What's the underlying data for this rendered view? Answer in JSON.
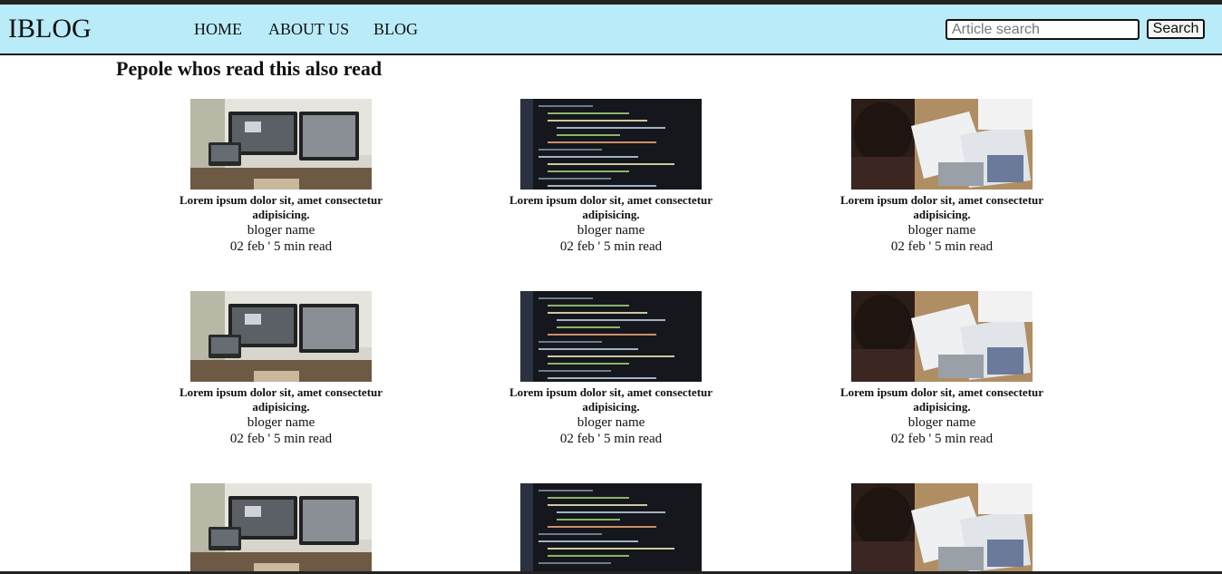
{
  "brand": "IBLOG",
  "nav": [
    {
      "label": "HOME"
    },
    {
      "label": "ABOUT US"
    },
    {
      "label": "BLOG"
    }
  ],
  "search": {
    "placeholder": "Article search",
    "button": "Search"
  },
  "section_title": "Pepole whos read this also read",
  "colors": {
    "navbar_bg": "#b9ebf8",
    "text": "#111111"
  },
  "cards": [
    {
      "image": "desk-monitors-image",
      "title": "Lorem ipsum dolor sit, amet consectetur adipisicing.",
      "author": "bloger name",
      "meta": "02 feb ' 5 min read"
    },
    {
      "image": "code-screen-image",
      "title": "Lorem ipsum dolor sit, amet consectetur adipisicing.",
      "author": "bloger name",
      "meta": "02 feb ' 5 min read"
    },
    {
      "image": "person-desk-image",
      "title": "Lorem ipsum dolor sit, amet consectetur adipisicing.",
      "author": "bloger name",
      "meta": "02 feb ' 5 min read"
    },
    {
      "image": "desk-monitors-image",
      "title": "Lorem ipsum dolor sit, amet consectetur adipisicing.",
      "author": "bloger name",
      "meta": "02 feb ' 5 min read"
    },
    {
      "image": "code-screen-image",
      "title": "Lorem ipsum dolor sit, amet consectetur adipisicing.",
      "author": "bloger name",
      "meta": "02 feb ' 5 min read"
    },
    {
      "image": "person-desk-image",
      "title": "Lorem ipsum dolor sit, amet consectetur adipisicing.",
      "author": "bloger name",
      "meta": "02 feb ' 5 min read"
    },
    {
      "image": "desk-monitors-image"
    },
    {
      "image": "code-screen-image"
    },
    {
      "image": "person-desk-image"
    }
  ]
}
